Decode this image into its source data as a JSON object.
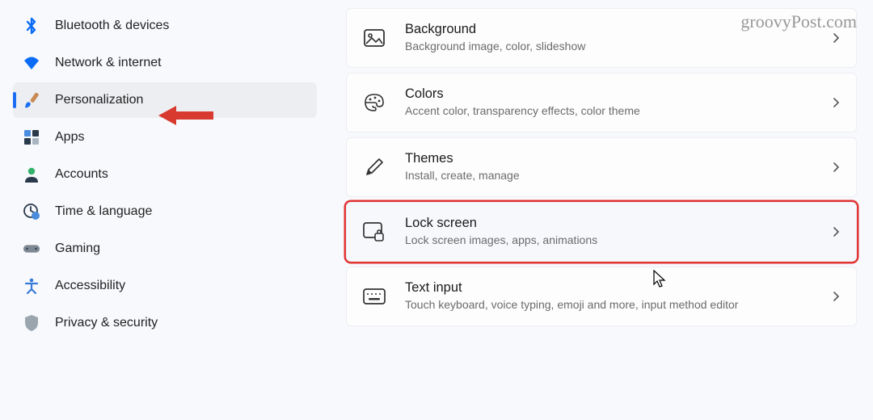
{
  "watermark": "groovyPost.com",
  "sidebar": {
    "items": [
      {
        "label": "Bluetooth & devices"
      },
      {
        "label": "Network & internet"
      },
      {
        "label": "Personalization"
      },
      {
        "label": "Apps"
      },
      {
        "label": "Accounts"
      },
      {
        "label": "Time & language"
      },
      {
        "label": "Gaming"
      },
      {
        "label": "Accessibility"
      },
      {
        "label": "Privacy & security"
      }
    ]
  },
  "main": {
    "cards": [
      {
        "title": "Background",
        "subtitle": "Background image, color, slideshow"
      },
      {
        "title": "Colors",
        "subtitle": "Accent color, transparency effects, color theme"
      },
      {
        "title": "Themes",
        "subtitle": "Install, create, manage"
      },
      {
        "title": "Lock screen",
        "subtitle": "Lock screen images, apps, animations"
      },
      {
        "title": "Text input",
        "subtitle": "Touch keyboard, voice typing, emoji and more, input method editor"
      }
    ]
  }
}
